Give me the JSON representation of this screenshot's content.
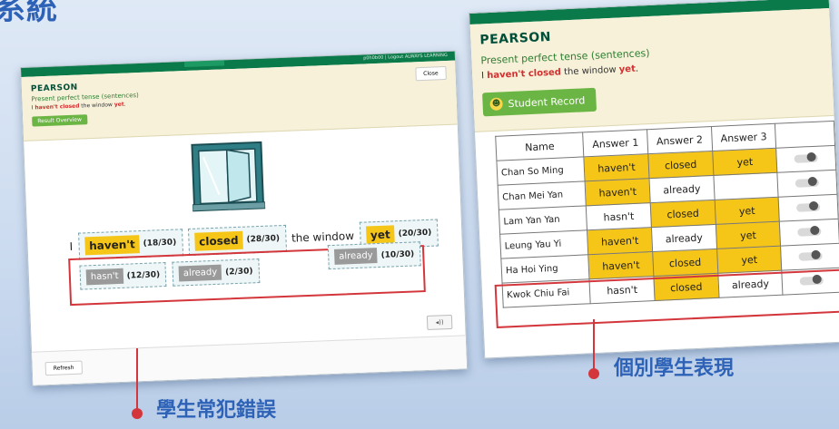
{
  "corner_title": "系統",
  "left": {
    "brand": "PEARSON",
    "topbar_center": "",
    "topbar_user": "p0h0b00 | Logout  ALWAYS LEARNING",
    "close_label": "Close",
    "lesson_title": "Present perfect tense (sentences)",
    "sentence": {
      "pre": "I",
      "w1": "haven't closed",
      "mid": "the window",
      "w2": "yet",
      "end": "."
    },
    "result_btn": "Result Overview",
    "sentence_row": {
      "start": "I",
      "c1": "haven't",
      "c1_count": "(18/30)",
      "c2": "closed",
      "c2_count": "(28/30)",
      "middle": "the window",
      "c3": "yet",
      "c3_count": "(20/30)"
    },
    "wrong": [
      {
        "word": "hasn't",
        "count": "(12/30)"
      },
      {
        "word": "already",
        "count": "(2/30)"
      },
      {
        "word": "already",
        "count": "(10/30)"
      }
    ],
    "refresh": "Refresh"
  },
  "right": {
    "brand": "PEARSON",
    "lesson_title": "Present perfect tense (sentences)",
    "sentence": {
      "pre": "I",
      "w1": "haven't closed",
      "mid": "the window",
      "w2": "yet",
      "end": "."
    },
    "student_record_btn": "Student Record",
    "headers": [
      "Name",
      "Answer 1",
      "Answer 2",
      "Answer 3"
    ],
    "rows": [
      {
        "name": "Chan So Ming",
        "a1": "haven't",
        "a2": "closed",
        "a3": "yet",
        "h": [
          true,
          true,
          true
        ]
      },
      {
        "name": "Chan Mei Yan",
        "a1": "haven't",
        "a2": "already",
        "a3": "",
        "h": [
          true,
          false,
          false
        ]
      },
      {
        "name": "Lam Yan Yan",
        "a1": "hasn't",
        "a2": "closed",
        "a3": "yet",
        "h": [
          false,
          true,
          true
        ]
      },
      {
        "name": "Leung Yau Yi",
        "a1": "haven't",
        "a2": "already",
        "a3": "yet",
        "h": [
          true,
          false,
          true
        ]
      },
      {
        "name": "Ha Hoi Ying",
        "a1": "haven't",
        "a2": "closed",
        "a3": "yet",
        "h": [
          true,
          true,
          true
        ]
      },
      {
        "name": "Kwok Chiu Fai",
        "a1": "hasn't",
        "a2": "closed",
        "a3": "already",
        "h": [
          false,
          true,
          false
        ]
      }
    ]
  },
  "captions": {
    "left": "學生常犯錯誤",
    "right": "個別學生表現"
  },
  "colors": {
    "accent_red": "#d3363b",
    "highlight": "#f5c518",
    "pearson_green": "#0b7a4a",
    "caption_blue": "#2d62b6"
  }
}
